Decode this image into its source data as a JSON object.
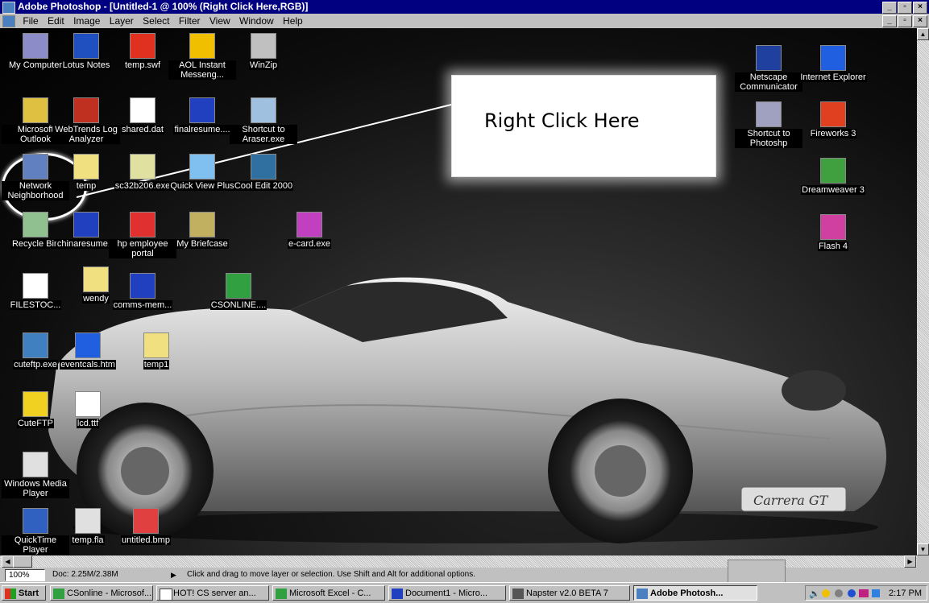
{
  "window": {
    "title": "Adobe Photoshop - [Untitled-1 @ 100% (Right Click Here,RGB)]"
  },
  "menu": [
    "File",
    "Edit",
    "Image",
    "Layer",
    "Select",
    "Filter",
    "View",
    "Window",
    "Help"
  ],
  "callout": {
    "text": "Right Click Here"
  },
  "desktop_icons_left": [
    {
      "label": "My Computer",
      "icon": "computer-icon",
      "color": "#8c8cc8"
    },
    {
      "label": "Lotus Notes",
      "icon": "lotus-notes-icon",
      "color": "#2050c0"
    },
    {
      "label": "temp.swf",
      "icon": "flash-file-icon",
      "color": "#e03020"
    },
    {
      "label": "AOL Instant Messeng...",
      "icon": "aim-icon",
      "color": "#f0c000"
    },
    {
      "label": "WinZip",
      "icon": "winzip-icon",
      "color": "#c0c0c0"
    },
    {
      "label": "Microsoft Outlook",
      "icon": "outlook-icon",
      "color": "#e0c040"
    },
    {
      "label": "WebTrends Log Analyzer",
      "icon": "webtrends-icon",
      "color": "#c03020"
    },
    {
      "label": "shared.dat",
      "icon": "file-icon",
      "color": "#ffffff"
    },
    {
      "label": "finalresume....",
      "icon": "word-doc-icon",
      "color": "#2040c0"
    },
    {
      "label": "Shortcut to Araser.exe",
      "icon": "eraser-icon",
      "color": "#a0c0e0"
    },
    {
      "label": "Network Neighborhood",
      "icon": "network-icon",
      "color": "#6080c0"
    },
    {
      "label": "temp",
      "icon": "folder-icon",
      "color": "#f0e080"
    },
    {
      "label": "sc32b206.exe",
      "icon": "installer-icon",
      "color": "#e0e0a0"
    },
    {
      "label": "Quick View Plus",
      "icon": "magnifier-icon",
      "color": "#80c0f0"
    },
    {
      "label": "Cool Edit 2000",
      "icon": "cool-edit-icon",
      "color": "#3070a0"
    },
    {
      "label": "Recycle Bin",
      "icon": "recycle-bin-icon",
      "color": "#90c090"
    },
    {
      "label": "chinaresume...",
      "icon": "word-doc-icon",
      "color": "#2040c0"
    },
    {
      "label": "hp employee portal",
      "icon": "hp-icon",
      "color": "#e03030"
    },
    {
      "label": "My Briefcase",
      "icon": "briefcase-icon",
      "color": "#c0b060"
    },
    {
      "label": "e-card.exe",
      "icon": "ecard-icon",
      "color": "#c040c0"
    },
    {
      "label": "wendy",
      "icon": "folder-icon",
      "color": "#f0e080"
    },
    {
      "label": "FILESTOC...",
      "icon": "text-file-icon",
      "color": "#ffffff"
    },
    {
      "label": "comms-mem...",
      "icon": "word-doc-icon",
      "color": "#2040c0"
    },
    {
      "label": "CSONLINE....",
      "icon": "excel-icon",
      "color": "#30a040"
    },
    {
      "label": "temp1",
      "icon": "folder-icon",
      "color": "#f0e080"
    },
    {
      "label": "cuteftp.exe",
      "icon": "cuteftp-exe-icon",
      "color": "#4080c0"
    },
    {
      "label": "eventcals.htm",
      "icon": "ie-document-icon",
      "color": "#2060e0"
    },
    {
      "label": "CuteFTP",
      "icon": "cuteftp-icon",
      "color": "#f0d020"
    },
    {
      "label": "lcd.ttf",
      "icon": "font-file-icon",
      "color": "#ffffff"
    },
    {
      "label": "Windows Media Player",
      "icon": "media-player-icon",
      "color": "#e0e0e0"
    },
    {
      "label": "QuickTime Player",
      "icon": "quicktime-icon",
      "color": "#3060c0"
    },
    {
      "label": "temp.fla",
      "icon": "fla-file-icon",
      "color": "#e0e0e0"
    },
    {
      "label": "untitled.bmp",
      "icon": "bmp-file-icon",
      "color": "#e04040"
    }
  ],
  "desktop_icons_right": [
    {
      "label": "Netscape Communicator",
      "icon": "netscape-icon",
      "color": "#2040a0"
    },
    {
      "label": "Internet Explorer",
      "icon": "internet-explorer-icon",
      "color": "#2060e0"
    },
    {
      "label": "Shortcut to Photoshp",
      "icon": "photoshop-icon",
      "color": "#a0a0c0"
    },
    {
      "label": "Fireworks 3",
      "icon": "fireworks-icon",
      "color": "#e04020"
    },
    {
      "label": "Dreamweaver 3",
      "icon": "dreamweaver-icon",
      "color": "#40a040"
    },
    {
      "label": "Flash 4",
      "icon": "flash-icon",
      "color": "#d040a0"
    }
  ],
  "status": {
    "zoom": "100%",
    "doc": "Doc: 2.25M/2.38M",
    "hint": "Click and drag to move layer or selection. Use Shift and Alt for additional options."
  },
  "taskbar": {
    "start": "Start",
    "buttons": [
      "CSonline - Microsof...",
      "HOT! CS server an...",
      "Microsoft Excel - C...",
      "Document1 - Micro...",
      "Napster v2.0 BETA 7",
      "Adobe Photosh..."
    ],
    "clock": "2:17 PM"
  }
}
